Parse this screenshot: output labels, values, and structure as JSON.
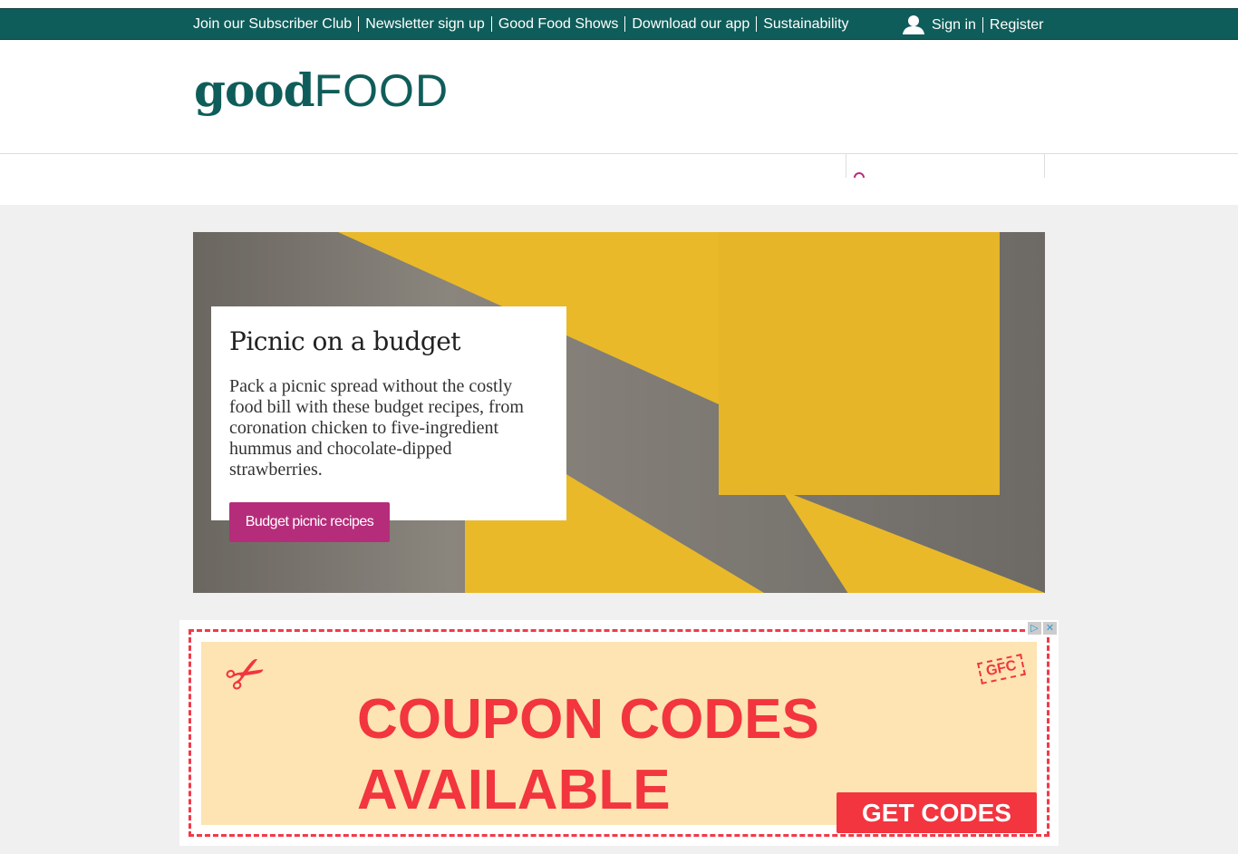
{
  "topbar": {
    "links": [
      "Join our Subscriber Club",
      "Newsletter sign up",
      "Good Food Shows",
      "Download our app",
      "Sustainability"
    ],
    "sign_in": "Sign in",
    "register": "Register",
    "icon": "user-icon"
  },
  "header": {
    "logo_good": "good",
    "logo_food": "FOOD",
    "search_icon": "search-icon"
  },
  "hero": {
    "title": "Picnic on a budget",
    "description": "Pack a picnic spread without the costly food bill with these budget recipes, from coronation chicken to five-ingredient hummus and chocolate-dipped strawberries.",
    "button": "Budget picnic recipes"
  },
  "ad": {
    "line1": "COUPON CODES",
    "line2": "AVAILABLE",
    "button": "GET CODES",
    "badge": "GFC",
    "icons": [
      "adchoices-icon",
      "close-icon"
    ],
    "colors": {
      "accent": "#f2353f",
      "background": "#fde4b2"
    }
  },
  "colors": {
    "brand": "#0f5d5a",
    "cta": "#b52d7a"
  }
}
